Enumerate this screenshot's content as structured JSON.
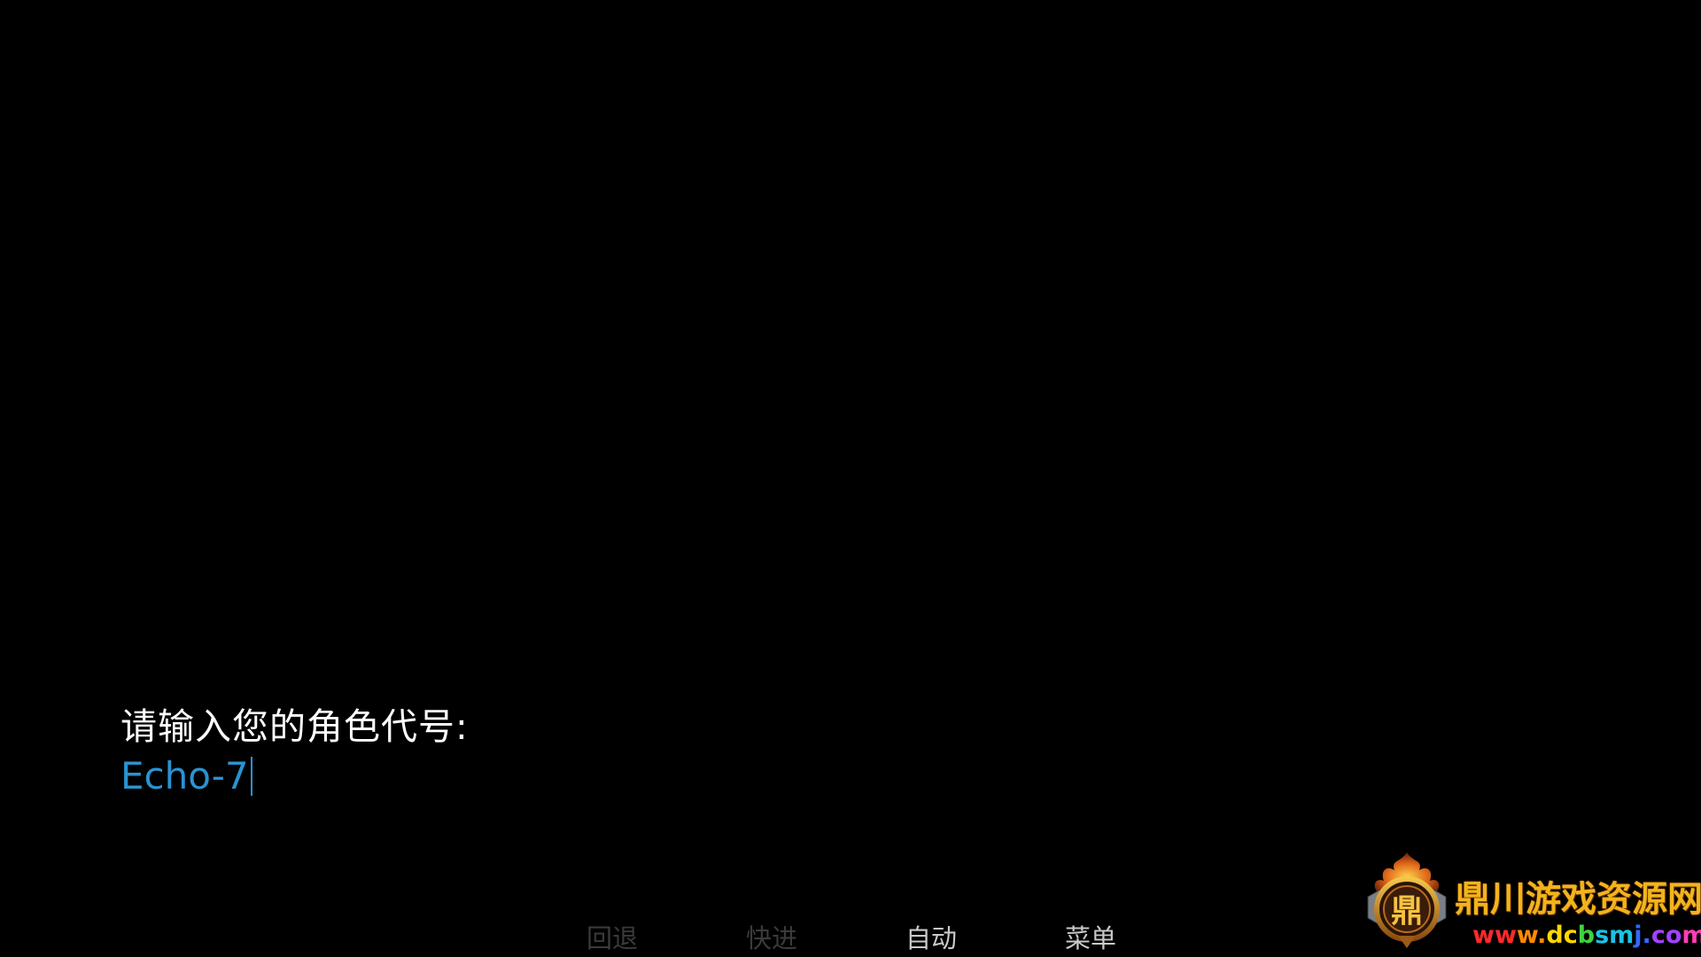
{
  "dialogue": {
    "prompt": "请输入您的角色代号:",
    "input_value": "Echo-7"
  },
  "quick_menu": {
    "items": [
      {
        "label": "回退",
        "enabled": false
      },
      {
        "label": "快进",
        "enabled": false
      },
      {
        "label": "自动",
        "enabled": true
      },
      {
        "label": "菜单",
        "enabled": true
      }
    ]
  },
  "watermark": {
    "title": "鼎川游戏资源网",
    "url": "www.dcbsmj.com",
    "emblem_char": "鼎"
  },
  "colors": {
    "background": "#000000",
    "prompt_text": "#ffffff",
    "input_text": "#2a93d1",
    "menu_disabled": "#3a3a3a",
    "menu_enabled": "#c9c9c9",
    "watermark_gold": "#f2b41c"
  }
}
